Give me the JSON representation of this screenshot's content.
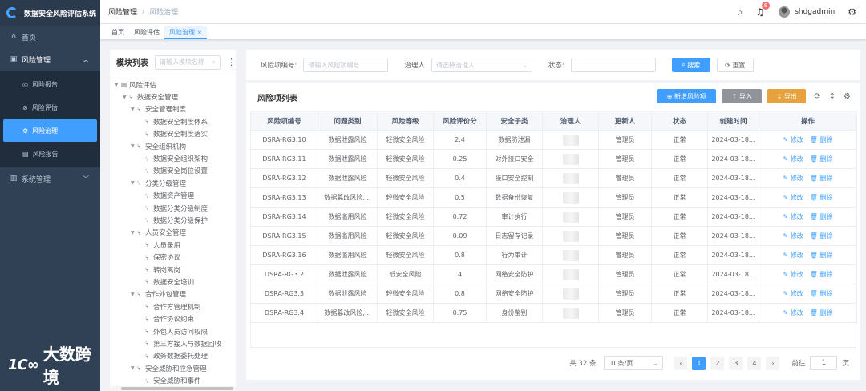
{
  "app": {
    "title": "数据安全风险评估系统"
  },
  "sidebar": {
    "items": [
      {
        "label": "首页",
        "icon": "home-icon"
      },
      {
        "label": "风险管理",
        "icon": "briefcase-icon",
        "children": [
          {
            "label": "风险报告",
            "icon": "target-icon"
          },
          {
            "label": "风险评估",
            "icon": "compass-icon"
          },
          {
            "label": "风险治理",
            "icon": "gear-icon",
            "active": true
          },
          {
            "label": "风险报告",
            "icon": "document-icon"
          }
        ]
      },
      {
        "label": "系统管理",
        "icon": "chart-icon"
      }
    ]
  },
  "watermark": {
    "logo": "大数跨境",
    "mark": "1C∞"
  },
  "header": {
    "breadcrumb": [
      "风险管理",
      "风险治理"
    ],
    "notification_count": "8",
    "username": "shdgadmin"
  },
  "tags": [
    "首页",
    "风险评估",
    "风险治理"
  ],
  "tree": {
    "title": "模块列表",
    "search_placeholder": "请输入模块名称",
    "nodes": [
      {
        "label": "风险评估",
        "level": 0,
        "type": "root"
      },
      {
        "label": "数据安全管理",
        "level": 1,
        "type": "branch"
      },
      {
        "label": "安全管理制度",
        "level": 2,
        "type": "branch"
      },
      {
        "label": "数据安全制度体系",
        "level": 3,
        "type": "leaf"
      },
      {
        "label": "数据安全制度落实",
        "level": 3,
        "type": "leaf"
      },
      {
        "label": "安全组织机构",
        "level": 2,
        "type": "branch"
      },
      {
        "label": "数据安全组织架构",
        "level": 3,
        "type": "leaf"
      },
      {
        "label": "数据安全岗位设置",
        "level": 3,
        "type": "leaf"
      },
      {
        "label": "分类分级管理",
        "level": 2,
        "type": "branch"
      },
      {
        "label": "数据资产管理",
        "level": 3,
        "type": "leaf"
      },
      {
        "label": "数据分类分级制度",
        "level": 3,
        "type": "leaf"
      },
      {
        "label": "数据分类分级保护",
        "level": 3,
        "type": "leaf"
      },
      {
        "label": "人员安全管理",
        "level": 2,
        "type": "branch"
      },
      {
        "label": "人员录用",
        "level": 3,
        "type": "leaf"
      },
      {
        "label": "保密协议",
        "level": 3,
        "type": "leaf"
      },
      {
        "label": "转岗离岗",
        "level": 3,
        "type": "leaf"
      },
      {
        "label": "数据安全培训",
        "level": 3,
        "type": "leaf"
      },
      {
        "label": "合作外包管理",
        "level": 2,
        "type": "branch"
      },
      {
        "label": "合作方管理机制",
        "level": 3,
        "type": "leaf"
      },
      {
        "label": "合作协议约束",
        "level": 3,
        "type": "leaf"
      },
      {
        "label": "外包人员访问权限",
        "level": 3,
        "type": "leaf"
      },
      {
        "label": "第三方接入与数据回收",
        "level": 3,
        "type": "leaf"
      },
      {
        "label": "政务数据委托处理",
        "level": 3,
        "type": "leaf"
      },
      {
        "label": "安全威胁和应急管理",
        "level": 2,
        "type": "branch"
      },
      {
        "label": "安全威胁和事件",
        "level": 3,
        "type": "leaf"
      }
    ]
  },
  "search": {
    "fields": [
      {
        "label": "风险项编号:",
        "placeholder": "请输入风险项编号"
      },
      {
        "label": "治理人",
        "placeholder": "请选择治理人"
      },
      {
        "label": "状态:",
        "placeholder": ""
      }
    ],
    "search_label": "搜索",
    "reset_label": "重置"
  },
  "list": {
    "title": "风险项列表",
    "add_label": "新增风险项",
    "import_label": "导入",
    "export_label": "导出",
    "colors": {
      "add": "#409eff",
      "import": "#909399",
      "export": "#e6a23c"
    },
    "columns": [
      "风险项编号",
      "问题类别",
      "风险等级",
      "风险评价分",
      "安全子类",
      "治理人",
      "更新人",
      "状态",
      "创建时间",
      "操作"
    ],
    "edit_label": "修改",
    "delete_label": "删除",
    "rows": [
      [
        "DSRA-RG3.10",
        "数据泄露风险",
        "轻微安全风险",
        "2.4",
        "数据防泄漏",
        "",
        "管理员",
        "正常",
        "2024-03-18..."
      ],
      [
        "DSRA-RG3.11",
        "数据泄露风险",
        "轻微安全风险",
        "0.25",
        "对外接口安全",
        "",
        "管理员",
        "正常",
        "2024-03-18..."
      ],
      [
        "DSRA-RG3.12",
        "数据泄露风险",
        "轻微安全风险",
        "0.4",
        "接口安全控制",
        "",
        "管理员",
        "正常",
        "2024-03-18..."
      ],
      [
        "DSRA-RG3.13",
        "数据篡改风险,...",
        "轻微安全风险",
        "0.5",
        "数据备份恢复",
        "",
        "管理员",
        "正常",
        "2024-03-18..."
      ],
      [
        "DSRA-RG3.14",
        "数据滥用风险",
        "轻微安全风险",
        "0.72",
        "审计执行",
        "",
        "管理员",
        "正常",
        "2024-03-18..."
      ],
      [
        "DSRA-RG3.15",
        "数据滥用风险",
        "轻微安全风险",
        "0.09",
        "日志留存记录",
        "",
        "管理员",
        "正常",
        "2024-03-18..."
      ],
      [
        "DSRA-RG3.16",
        "数据滥用风险",
        "轻微安全风险",
        "0.8",
        "行为审计",
        "",
        "管理员",
        "正常",
        "2024-03-18..."
      ],
      [
        "DSRA-RG3.2",
        "数据泄露风险",
        "低安全风险",
        "4",
        "网络安全防护",
        "",
        "管理员",
        "正常",
        "2024-03-18..."
      ],
      [
        "DSRA-RG3.3",
        "数据泄露风险",
        "轻微安全风险",
        "0.8",
        "网络安全防护",
        "",
        "管理员",
        "正常",
        "2024-03-18..."
      ],
      [
        "DSRA-RG3.4",
        "数据篡改风险,...",
        "轻微安全风险",
        "0.75",
        "身份鉴别",
        "",
        "管理员",
        "正常",
        "2024-03-18..."
      ]
    ]
  },
  "pager": {
    "total_label": "共 32 条",
    "page_size": "10条/页",
    "pages": [
      "1",
      "2",
      "3",
      "4"
    ],
    "current": "1",
    "goto_label": "前往",
    "goto_value": "1",
    "page_unit": "页"
  }
}
